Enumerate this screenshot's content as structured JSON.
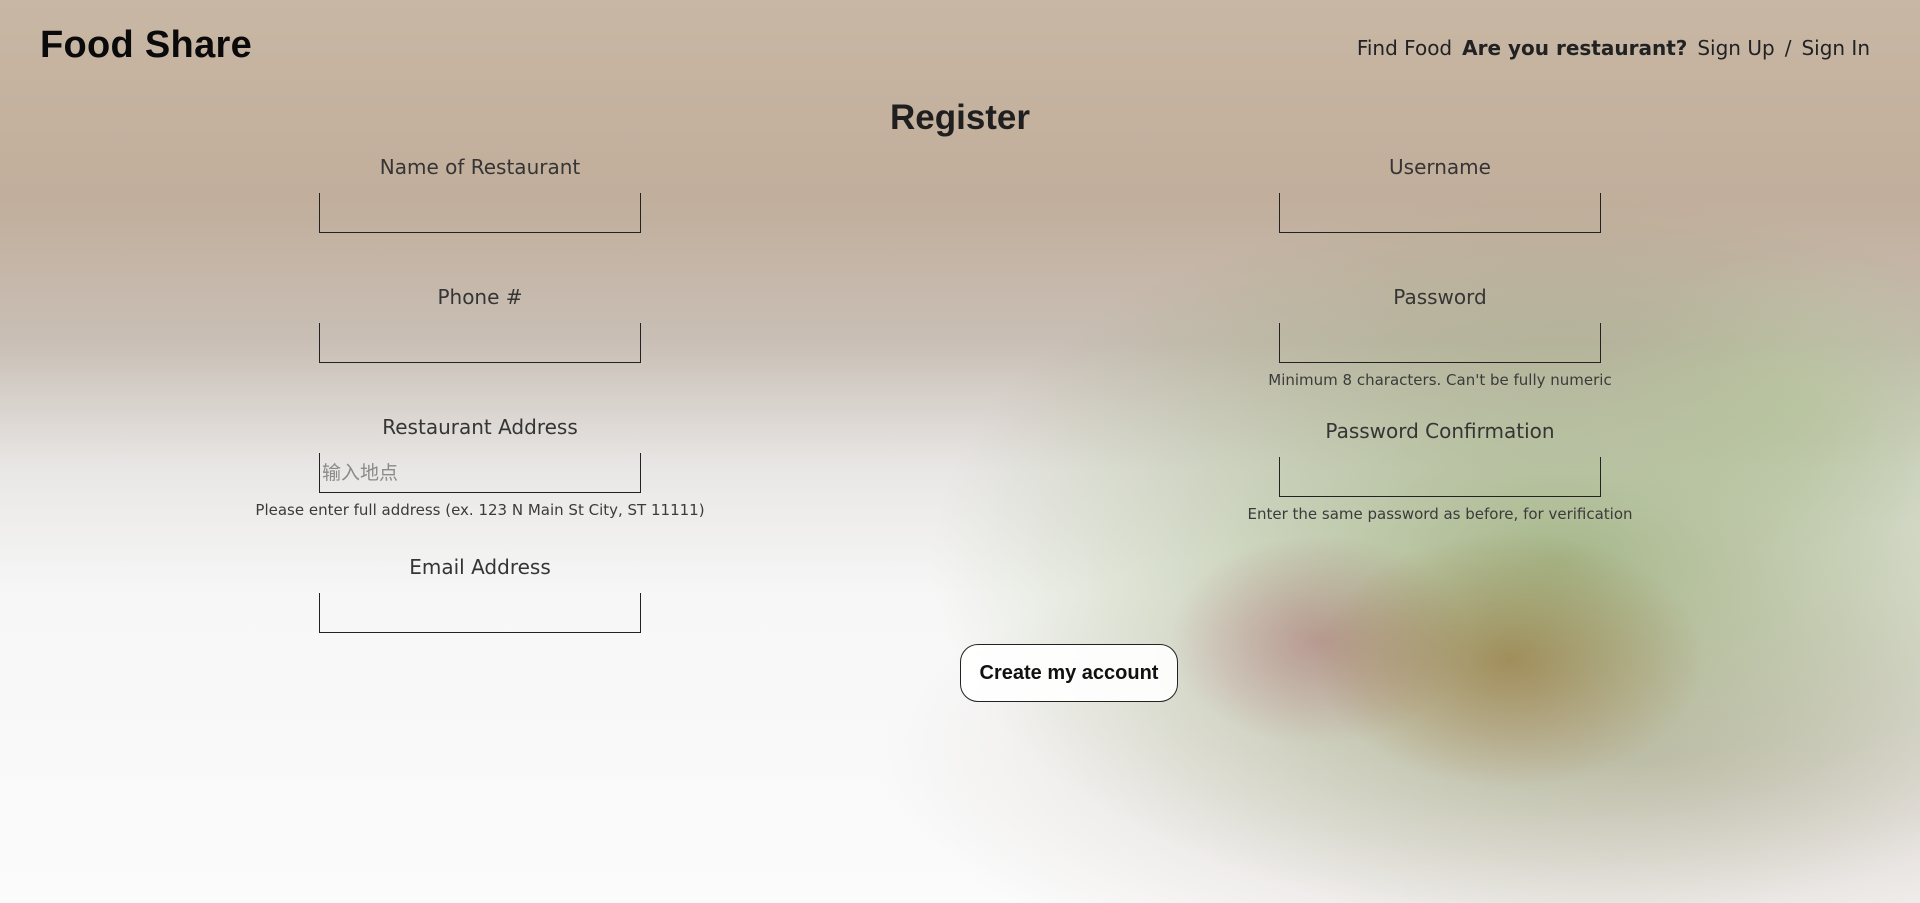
{
  "header": {
    "logo": "Food Share",
    "nav": {
      "find_food": "Find Food",
      "are_you_restaurant": "Are you restaurant?",
      "sign_up": "Sign Up",
      "separator": "/",
      "sign_in": "Sign In"
    }
  },
  "page_title": "Register",
  "form": {
    "restaurant_name": {
      "label": "Name of Restaurant",
      "value": "",
      "placeholder": ""
    },
    "phone": {
      "label": "Phone #",
      "value": "",
      "placeholder": ""
    },
    "address": {
      "label": "Restaurant Address",
      "value": "",
      "placeholder": "输入地点",
      "hint": "Please enter full address (ex. 123 N Main St City, ST 11111)"
    },
    "email": {
      "label": "Email Address",
      "value": "",
      "placeholder": ""
    },
    "username": {
      "label": "Username",
      "value": "",
      "placeholder": ""
    },
    "password": {
      "label": "Password",
      "value": "",
      "placeholder": "",
      "hint": "Minimum 8 characters. Can't be fully numeric"
    },
    "password_confirmation": {
      "label": "Password Confirmation",
      "value": "",
      "placeholder": "",
      "hint": "Enter the same password as before, for verification"
    },
    "submit_label": "Create my account"
  }
}
